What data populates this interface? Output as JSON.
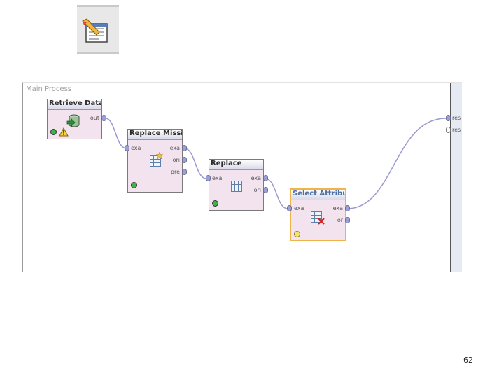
{
  "canvas": {
    "title": "Main Process",
    "result_ports": [
      {
        "label": "res"
      },
      {
        "label": "res"
      }
    ]
  },
  "operators": {
    "retrieve": {
      "title": "Retrieve Data...",
      "out_port": "out",
      "status": "green",
      "warning": true
    },
    "replace_missing": {
      "title": "Replace Missi...",
      "in_port": "exa",
      "out_ports": [
        "exa",
        "ori",
        "pre"
      ],
      "status": "green"
    },
    "replace": {
      "title": "Replace",
      "in_port": "exa",
      "out_ports": [
        "exa",
        "ori"
      ],
      "status": "green"
    },
    "select_attributes": {
      "title": "Select Attribu...",
      "in_port": "exa",
      "out_ports": [
        "exa",
        "or"
      ],
      "status": "yellow",
      "selected": true
    }
  },
  "page_number": "62",
  "colors": {
    "operator_bg": "#f2e3ee",
    "port_fill": "#9aa0d8",
    "connection": "#9a9ad0",
    "selected_border": "#f0b24a"
  }
}
